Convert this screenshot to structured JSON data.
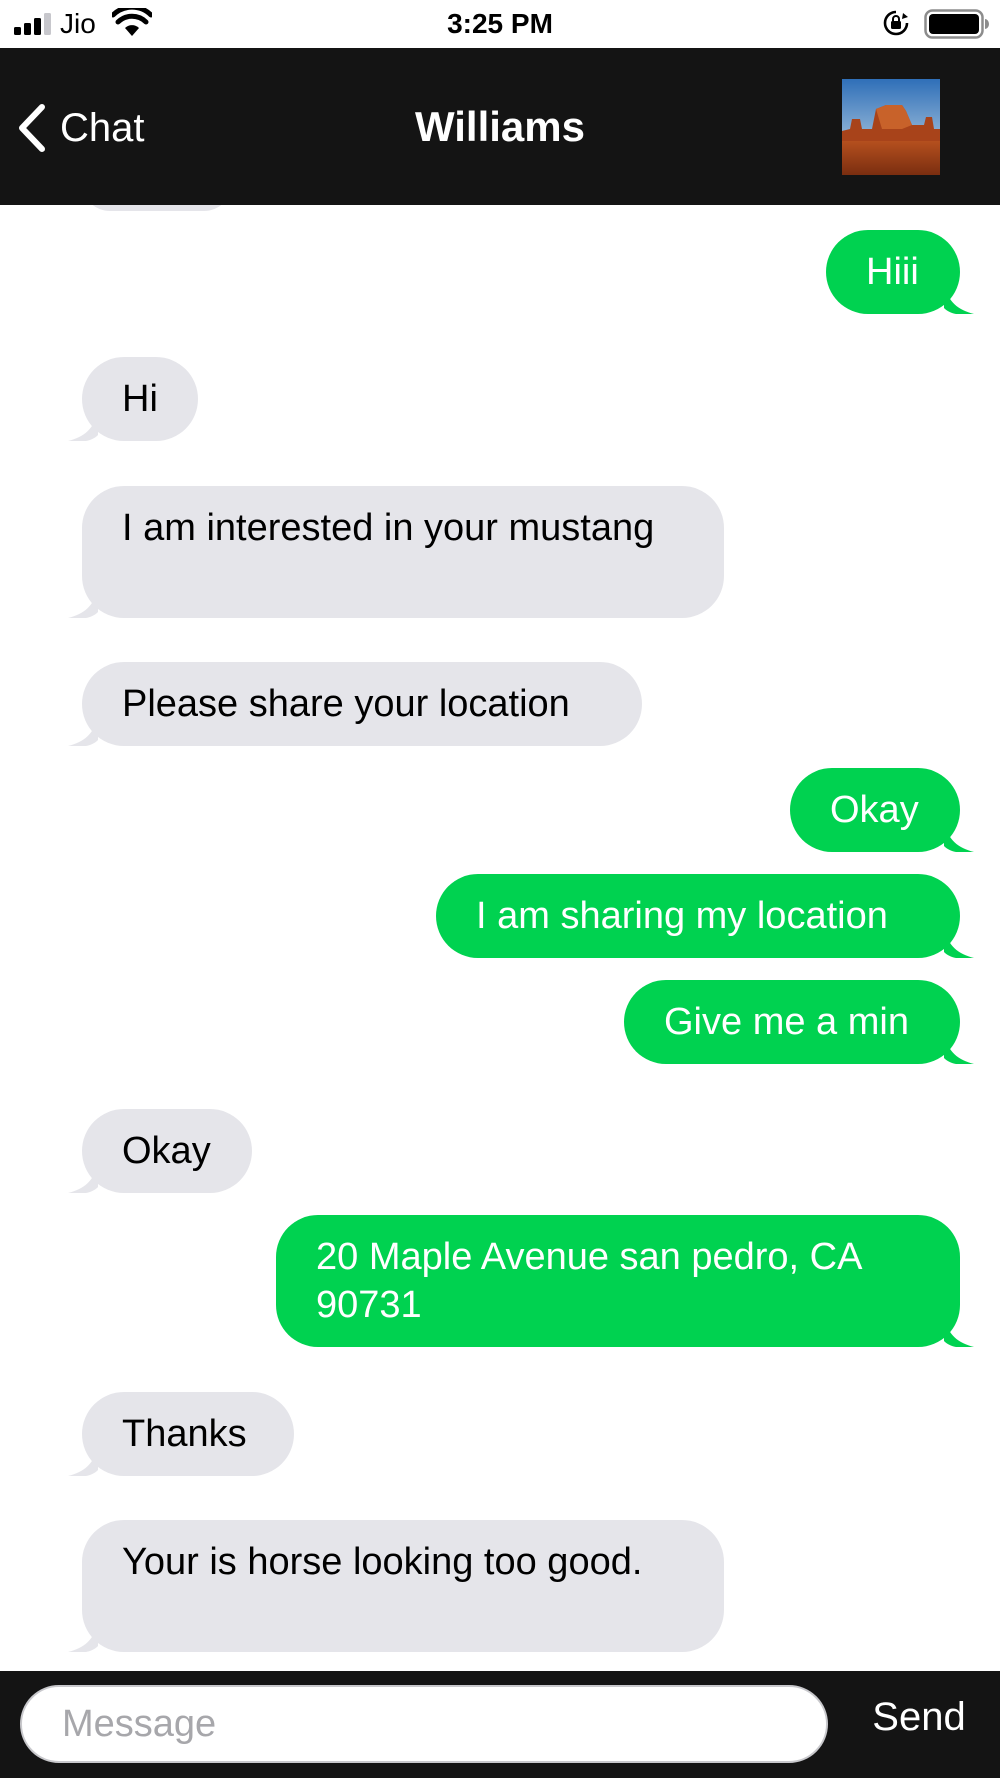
{
  "status_bar": {
    "carrier": "Jio",
    "time": "3:25 PM"
  },
  "nav": {
    "back_label": "Chat",
    "title": "Williams",
    "avatar_icon": "desert-landscape-photo"
  },
  "messages": [
    {
      "direction": "out",
      "text": "Hiii"
    },
    {
      "direction": "in",
      "text": "Hi"
    },
    {
      "direction": "in",
      "text": "I am interested in your mustang"
    },
    {
      "direction": "in",
      "text": "Please share your location"
    },
    {
      "direction": "out",
      "text": "Okay"
    },
    {
      "direction": "out",
      "text": "I am sharing my location"
    },
    {
      "direction": "out",
      "text": "Give me a min"
    },
    {
      "direction": "in",
      "text": "Okay"
    },
    {
      "direction": "out",
      "text": "20 Maple Avenue san pedro, CA 90731"
    },
    {
      "direction": "in",
      "text": "Thanks"
    },
    {
      "direction": "in",
      "text": "Your is horse looking too good."
    }
  ],
  "composer": {
    "placeholder": "Message",
    "send_label": "Send"
  },
  "colors": {
    "outgoing_bubble": "#00d250",
    "incoming_bubble": "#e5e5ea",
    "bar_background": "#141414"
  }
}
